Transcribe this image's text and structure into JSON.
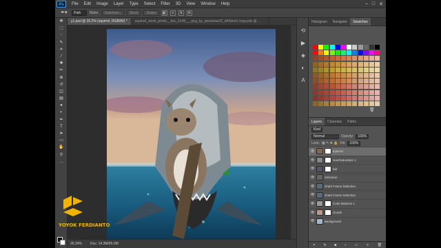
{
  "app": {
    "logo": "Ps"
  },
  "menu": [
    "File",
    "Edit",
    "Image",
    "Layer",
    "Type",
    "Select",
    "Filter",
    "3D",
    "View",
    "Window",
    "Help"
  ],
  "window_controls": [
    "minimize-icon",
    "maximize-icon",
    "close-icon"
  ],
  "options_bar": {
    "tool_icon": "pen-icon",
    "mode": "Path",
    "make_label": "Make:",
    "selection_btn": "Selection...",
    "mask_btn": "Mask",
    "shape_btn": "Shape"
  },
  "tools": [
    "move-icon",
    "marquee-icon",
    "lasso-icon",
    "quick-select-icon",
    "crop-icon",
    "eyedropper-icon",
    "healing-icon",
    "brush-icon",
    "stamp-icon",
    "history-brush-icon",
    "eraser-icon",
    "gradient-icon",
    "blur-icon",
    "dodge-icon",
    "pen-icon",
    "type-icon",
    "path-select-icon",
    "shape-icon",
    "hand-icon",
    "zoom-icon",
    "more-icon"
  ],
  "tool_glyphs": [
    "✥",
    "⬚",
    "◌",
    "✎",
    "⌗",
    "⁄",
    "✚",
    "✏",
    "⊕",
    "↺",
    "◫",
    "▤",
    "●",
    "◐",
    "✒",
    "T",
    "➤",
    "▭",
    "✋",
    "⚲",
    "…"
  ],
  "document_tabs": [
    {
      "label": "y1.psd @ 26.2% (squirrel, RGB/8#) *",
      "active": true
    },
    {
      "label": "squirrel_stock_photo__dsc_0149___png_by_annamae22_d43dso3 copy.psb @ ...",
      "active": false
    }
  ],
  "status": {
    "zoom": "26.24%",
    "doc": "Doc: 14.3M/95.0M"
  },
  "panel_tabs_top": [
    {
      "label": "Histogram",
      "active": false
    },
    {
      "label": "Navigator",
      "active": false
    },
    {
      "label": "Swatches",
      "active": true
    }
  ],
  "panel_tabs_layers": [
    {
      "label": "Layers",
      "active": true
    },
    {
      "label": "Channels",
      "active": false
    },
    {
      "label": "Paths",
      "active": false
    }
  ],
  "layers_panel": {
    "filter_kind": "Kind",
    "blend_mode": "Normal",
    "opacity_label": "Opacity:",
    "opacity_value": "100%",
    "lock_label": "Lock:",
    "fill_label": "Fill:",
    "fill_value": "100%",
    "layers": [
      {
        "name": "squirrel",
        "selected": true,
        "thumb": "#7a6a55",
        "mask": true
      },
      {
        "name": "Hue/Saturation 1",
        "selected": false,
        "thumb": "#888",
        "mask": true
      },
      {
        "name": "bat",
        "selected": false,
        "thumb": "#556",
        "mask": true
      },
      {
        "name": "Selection",
        "selected": false,
        "thumb": "#666",
        "mask": false
      },
      {
        "name": "shark Frame Selection",
        "selected": false,
        "thumb": "#5a6b78",
        "mask": false
      },
      {
        "name": "shark Frame Selection",
        "selected": false,
        "thumb": "#5a6b78",
        "mask": false
      },
      {
        "name": "Color Balance 1",
        "selected": false,
        "thumb": "#999",
        "mask": true
      },
      {
        "name": "clouds",
        "selected": false,
        "thumb": "#b89a8a",
        "mask": true
      },
      {
        "name": "Background",
        "selected": false,
        "thumb": "#a0b8c8",
        "mask": false
      }
    ]
  },
  "watermark": {
    "text": "YOYOK FERDIANTO"
  },
  "colors": {
    "accent": "#31a8ff",
    "watermark": "#f0b400",
    "panel_bg": "#535353"
  }
}
